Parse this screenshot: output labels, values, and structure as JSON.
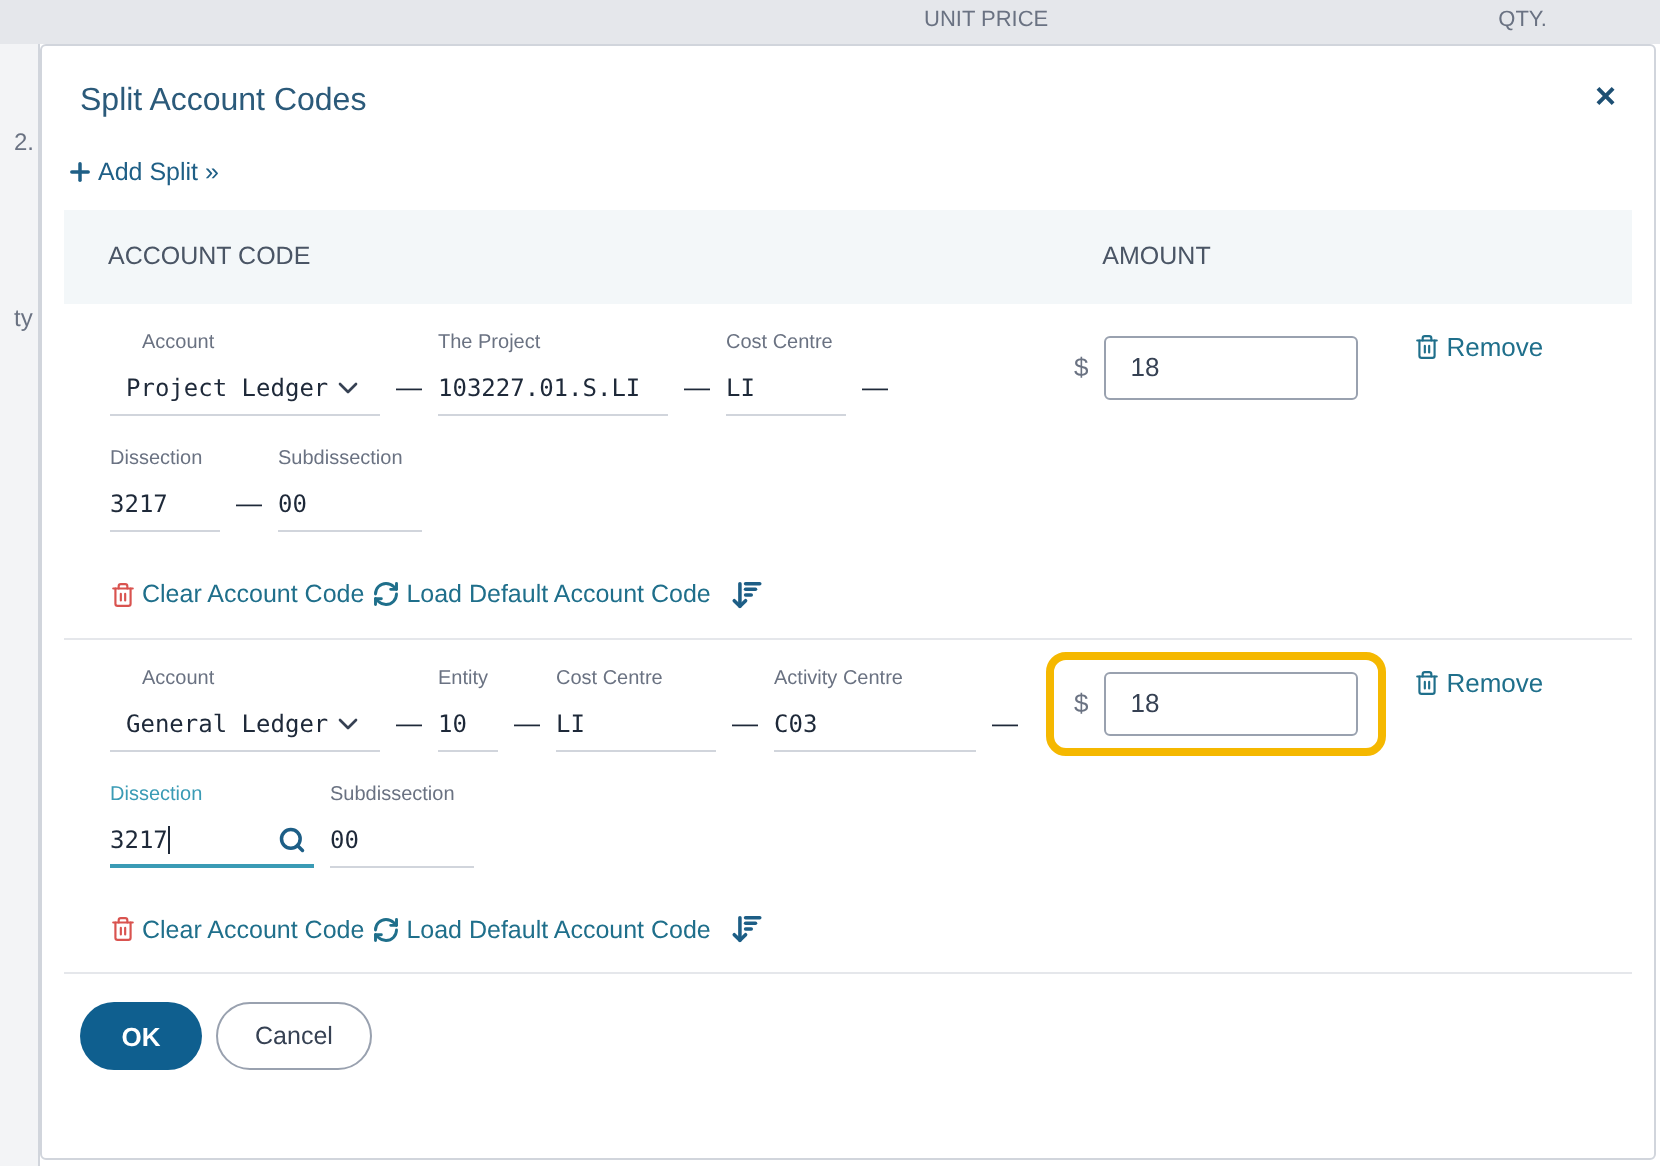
{
  "background": {
    "columns": [
      "UNIT PRICE",
      "QTY."
    ],
    "fragments": [
      "2.",
      "ty"
    ]
  },
  "dialog": {
    "title": "Split Account Codes",
    "close": "×",
    "add_split": "Add Split »",
    "header": {
      "account_code": "ACCOUNT CODE",
      "amount": "AMOUNT"
    },
    "splits": [
      {
        "fields": [
          {
            "kind": "select",
            "label": "Account",
            "value": "Project Ledger",
            "focused": false,
            "separator": "—"
          },
          {
            "kind": "text",
            "label": "The Project",
            "value": "103227.01.S.LI",
            "focused": false,
            "separator": "—"
          },
          {
            "kind": "text",
            "label": "Cost Centre",
            "value": "LI",
            "focused": false,
            "separator": "—"
          }
        ],
        "subfields": [
          {
            "label": "Dissection",
            "value": "3217",
            "focused": false,
            "search": false,
            "separator": "—"
          },
          {
            "label": "Subdissection",
            "value": "00",
            "focused": false,
            "search": false
          }
        ],
        "currency": "$",
        "amount": "18",
        "highlighted": false,
        "remove": "Remove",
        "clear": "Clear Account Code",
        "load_default": "Load Default Account Code"
      },
      {
        "fields": [
          {
            "kind": "select",
            "label": "Account",
            "value": "General Ledger",
            "focused": false,
            "separator": "—"
          },
          {
            "kind": "text",
            "label": "Entity",
            "value": "10",
            "focused": false,
            "separator": "—"
          },
          {
            "kind": "text",
            "label": "Cost Centre",
            "value": "LI",
            "focused": false,
            "separator": "—"
          },
          {
            "kind": "text",
            "label": "Activity Centre",
            "value": "C03",
            "focused": false,
            "separator": "—"
          }
        ],
        "subfields": [
          {
            "label": "Dissection",
            "value": "3217",
            "focused": true,
            "search": true
          },
          {
            "label": "Subdissection",
            "value": "00",
            "focused": false,
            "search": false
          }
        ],
        "currency": "$",
        "amount": "18",
        "highlighted": true,
        "remove": "Remove",
        "clear": "Clear Account Code",
        "load_default": "Load Default Account Code"
      }
    ],
    "buttons": {
      "ok": "OK",
      "cancel": "Cancel"
    }
  }
}
